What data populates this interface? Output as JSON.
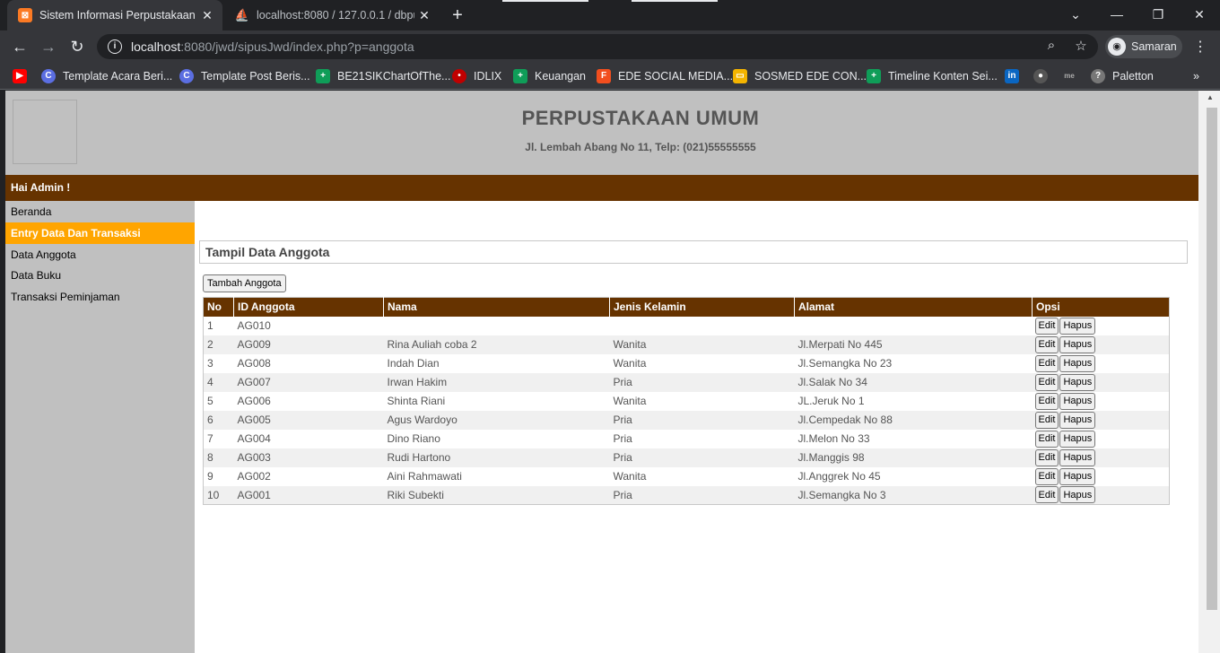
{
  "browser": {
    "tabs": [
      {
        "title": "Sistem Informasi Perpustakaan",
        "icon": "xampp-icon",
        "active": true
      },
      {
        "title": "localhost:8080 / 127.0.0.1 / dbpu",
        "icon": "phpmyadmin-icon",
        "active": false
      }
    ],
    "url_host": "localhost",
    "url_rest": ":8080/jwd/sipusJwd/index.php?p=anggota",
    "profile_name": "Samaran",
    "bookmarks": [
      {
        "label": "",
        "icon": "youtube-icon",
        "color": "#ff0000"
      },
      {
        "label": "Template Acara Beri...",
        "icon": "canva-icon",
        "color": "#5b6ee1"
      },
      {
        "label": "Template Post Beris...",
        "icon": "canva-icon",
        "color": "#5b6ee1"
      },
      {
        "label": "BE21SIKChartOfThe...",
        "icon": "sheets-icon",
        "color": "#0f9d58"
      },
      {
        "label": "IDLIX",
        "icon": "idlix-icon",
        "color": "#c00000"
      },
      {
        "label": "Keuangan",
        "icon": "sheets-icon",
        "color": "#0f9d58"
      },
      {
        "label": "EDE SOCIAL MEDIA...",
        "icon": "figma-icon",
        "color": "#f24e1e"
      },
      {
        "label": "SOSMED EDE CON...",
        "icon": "slides-icon",
        "color": "#f4b400"
      },
      {
        "label": "Timeline Konten Sei...",
        "icon": "sheets-icon",
        "color": "#0f9d58"
      },
      {
        "label": "",
        "icon": "linkedin-icon",
        "color": "#0a66c2"
      },
      {
        "label": "",
        "icon": "github-icon",
        "color": "#555555"
      },
      {
        "label": "",
        "icon": "me-icon",
        "color": "#888888"
      },
      {
        "label": "Paletton",
        "icon": "paletton-icon",
        "color": "#777777"
      }
    ]
  },
  "page": {
    "site_title": "PERPUSTAKAAN UMUM",
    "site_address": "Jl. Lembah Abang No 11, Telp: (021)55555555",
    "greeting": "Hai Admin !",
    "menu": [
      {
        "label": "Beranda",
        "active": false
      },
      {
        "label": "Entry Data Dan Transaksi",
        "active": true
      },
      {
        "label": "Data Anggota",
        "active": false
      },
      {
        "label": "Data Buku",
        "active": false
      },
      {
        "label": "Transaksi Peminjaman",
        "active": false
      }
    ],
    "panel_title": "Tampil Data Anggota",
    "add_button": "Tambah Anggota",
    "table": {
      "headers": [
        "No",
        "ID Anggota",
        "Nama",
        "Jenis Kelamin",
        "Alamat",
        "Opsi"
      ],
      "edit_label": "Edit",
      "delete_label": "Hapus",
      "rows": [
        {
          "no": "1",
          "id": "AG010",
          "nama": "",
          "jk": "",
          "alamat": ""
        },
        {
          "no": "2",
          "id": "AG009",
          "nama": "Rina Auliah coba 2",
          "jk": "Wanita",
          "alamat": "Jl.Merpati No 445"
        },
        {
          "no": "3",
          "id": "AG008",
          "nama": "Indah Dian",
          "jk": "Wanita",
          "alamat": "Jl.Semangka No 23"
        },
        {
          "no": "4",
          "id": "AG007",
          "nama": "Irwan Hakim",
          "jk": "Pria",
          "alamat": "Jl.Salak No 34"
        },
        {
          "no": "5",
          "id": "AG006",
          "nama": "Shinta Riani",
          "jk": "Wanita",
          "alamat": "JL.Jeruk No 1"
        },
        {
          "no": "6",
          "id": "AG005",
          "nama": "Agus Wardoyo",
          "jk": "Pria",
          "alamat": "Jl.Cempedak No 88"
        },
        {
          "no": "7",
          "id": "AG004",
          "nama": "Dino Riano",
          "jk": "Pria",
          "alamat": "Jl.Melon No 33"
        },
        {
          "no": "8",
          "id": "AG003",
          "nama": "Rudi Hartono",
          "jk": "Pria",
          "alamat": "Jl.Manggis 98"
        },
        {
          "no": "9",
          "id": "AG002",
          "nama": "Aini Rahmawati",
          "jk": "Wanita",
          "alamat": "Jl.Anggrek No 45"
        },
        {
          "no": "10",
          "id": "AG001",
          "nama": "Riki Subekti",
          "jk": "Pria",
          "alamat": "Jl.Semangka No 3"
        }
      ]
    }
  }
}
